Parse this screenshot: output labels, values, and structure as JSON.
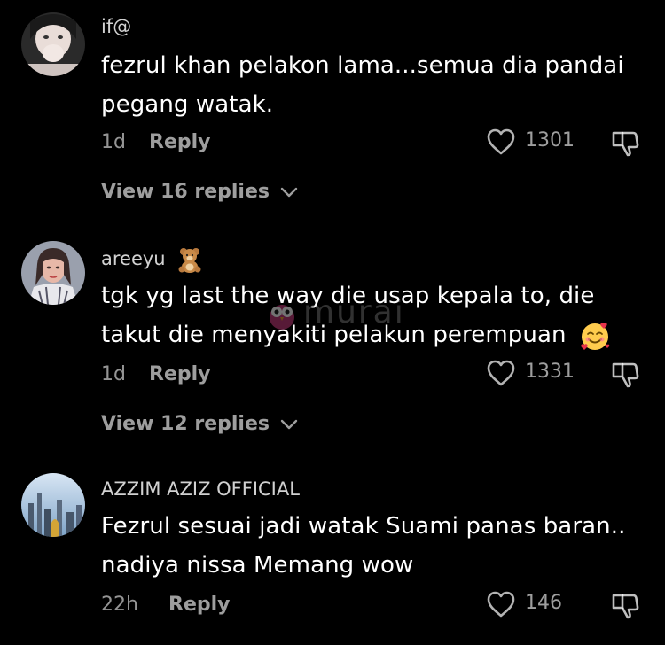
{
  "comments": [
    {
      "username": "if@",
      "text": "fezrul khan pelakon lama...semua dia pandai pegang watak.",
      "time": "1d",
      "reply_label": "Reply",
      "likes": "1301",
      "view_replies": "View 16 replies"
    },
    {
      "username": "areeyu",
      "username_emoji": "teddy-bear-icon",
      "text": "tgk yg last the way die usap kepala to, die takut die menyakiti pelakun perempuan",
      "text_emoji": "smiling-face-with-hearts-icon",
      "time": "1d",
      "reply_label": "Reply",
      "likes": "1331",
      "view_replies": "View 12 replies"
    },
    {
      "username": "AZZIM AZIZ OFFICIAL",
      "text": "Fezrul sesuai jadi watak Suami panas baran.. nadiya nissa Memang wow",
      "time": "22h",
      "reply_label": "Reply",
      "likes": "146"
    }
  ],
  "watermark": "murai",
  "colors": {
    "background": "#000000",
    "text": "#ffffff",
    "muted": "#9a9a9a"
  }
}
